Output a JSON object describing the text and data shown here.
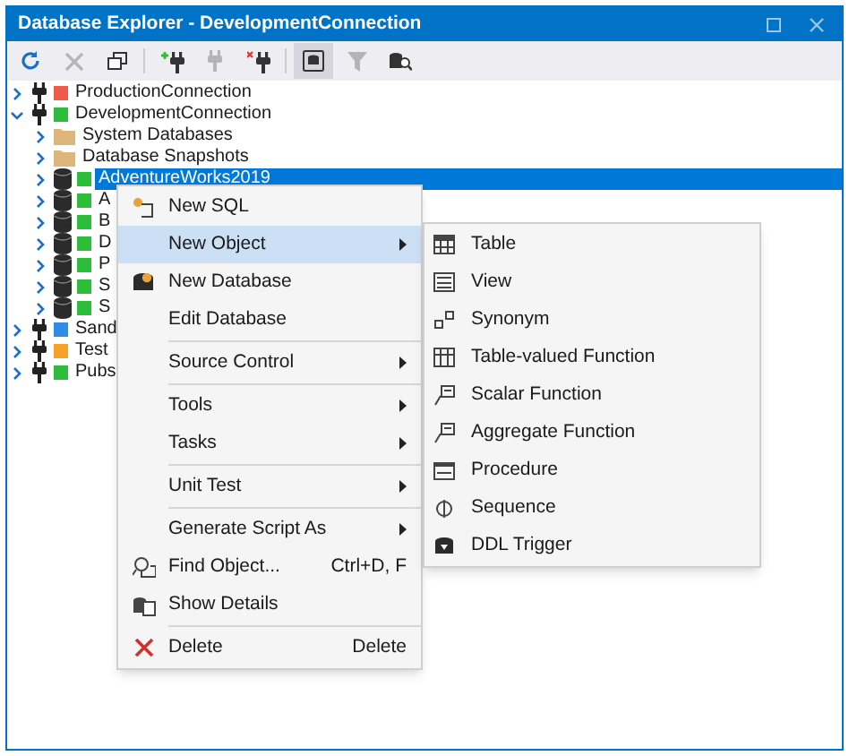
{
  "window": {
    "title": "Database Explorer - DevelopmentConnection"
  },
  "toolbar": [
    {
      "disabled": false,
      "pressed": false
    },
    {
      "disabled": true,
      "pressed": false
    },
    {
      "disabled": false,
      "pressed": false
    },
    {
      "disabled": false,
      "pressed": false
    },
    {
      "disabled": true,
      "pressed": false
    },
    {
      "disabled": false,
      "pressed": false
    },
    {
      "disabled": false,
      "pressed": true
    },
    {
      "disabled": true,
      "pressed": false
    },
    {
      "disabled": false,
      "pressed": false
    }
  ],
  "tree": [
    {
      "kind": "connection",
      "label": "ProductionConnection",
      "color": "#f05a4a",
      "expanded": false,
      "selected": false
    },
    {
      "kind": "connection",
      "label": "DevelopmentConnection",
      "color": "#2ebd3a",
      "expanded": true,
      "selected": false,
      "children": [
        {
          "kind": "folder",
          "label": "System Databases",
          "expanded": false,
          "selected": false
        },
        {
          "kind": "folder",
          "label": "Database Snapshots",
          "expanded": false,
          "selected": false
        },
        {
          "kind": "database",
          "label": "AdventureWorks2019",
          "color": "#2ebd3a",
          "expanded": false,
          "selected": true
        },
        {
          "kind": "database",
          "label": "A",
          "color": "#2ebd3a",
          "expanded": false,
          "selected": false
        },
        {
          "kind": "database",
          "label": "B",
          "color": "#2ebd3a",
          "expanded": false,
          "selected": false
        },
        {
          "kind": "database",
          "label": "D",
          "color": "#2ebd3a",
          "expanded": false,
          "selected": false
        },
        {
          "kind": "database",
          "label": "P",
          "color": "#2ebd3a",
          "expanded": false,
          "selected": false
        },
        {
          "kind": "database",
          "label": "S",
          "color": "#2ebd3a",
          "expanded": false,
          "selected": false
        },
        {
          "kind": "database",
          "label": "S",
          "color": "#2ebd3a",
          "expanded": false,
          "selected": false
        }
      ]
    },
    {
      "kind": "connection",
      "label": "Sand",
      "color": "#2f8be6",
      "expanded": false,
      "selected": false
    },
    {
      "kind": "connection",
      "label": "Test",
      "color": "#f7a12a",
      "expanded": false,
      "selected": false
    },
    {
      "kind": "connection",
      "label": "Pubs",
      "color": "#2ebd3a",
      "expanded": false,
      "selected": false
    }
  ],
  "context_menu": [
    {
      "label": "New SQL",
      "selected": false,
      "separator_before": false,
      "submenu": false
    },
    {
      "label": "New Object",
      "selected": true,
      "separator_before": false,
      "submenu": true
    },
    {
      "label": "New Database",
      "selected": false,
      "separator_before": false,
      "submenu": false
    },
    {
      "label": "Edit Database",
      "selected": false,
      "separator_before": false,
      "submenu": false
    },
    {
      "label": "Source Control",
      "selected": false,
      "separator_before": true,
      "submenu": true
    },
    {
      "label": "Tools",
      "selected": false,
      "separator_before": true,
      "submenu": true
    },
    {
      "label": "Tasks",
      "selected": false,
      "separator_before": false,
      "submenu": true
    },
    {
      "label": "Unit Test",
      "selected": false,
      "separator_before": true,
      "submenu": true
    },
    {
      "label": "Generate Script As",
      "selected": false,
      "separator_before": true,
      "submenu": true
    },
    {
      "label": "Find Object...",
      "shortcut": "Ctrl+D, F",
      "selected": false,
      "separator_before": false,
      "submenu": false
    },
    {
      "label": "Show Details",
      "selected": false,
      "separator_before": false,
      "submenu": false
    },
    {
      "label": "Delete",
      "shortcut": "Delete",
      "selected": false,
      "separator_before": true,
      "submenu": false
    }
  ],
  "submenu": [
    {
      "label": "Table"
    },
    {
      "label": "View"
    },
    {
      "label": "Synonym"
    },
    {
      "label": "Table-valued Function"
    },
    {
      "label": "Scalar Function"
    },
    {
      "label": "Aggregate Function"
    },
    {
      "label": "Procedure"
    },
    {
      "label": "Sequence"
    },
    {
      "label": "DDL Trigger"
    }
  ]
}
